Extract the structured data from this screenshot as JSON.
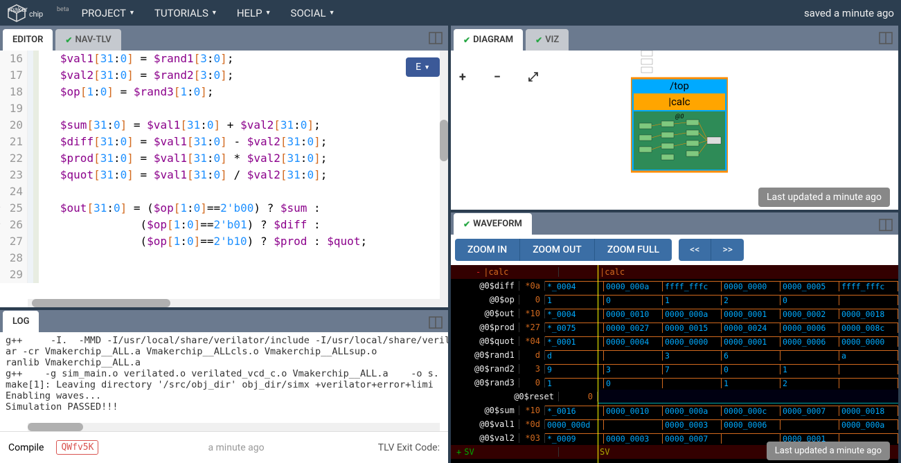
{
  "header": {
    "logo": "makerchip",
    "beta": "beta",
    "menu": [
      "PROJECT",
      "TUTORIALS",
      "HELP",
      "SOCIAL"
    ],
    "saved": "saved a minute ago"
  },
  "editor": {
    "tab_editor": "EDITOR",
    "tab_navtlv": "NAV-TLV",
    "e_btn": "E",
    "lines": [
      {
        "n": "16",
        "code": "   $val1[31:0] = $rand1[3:0];"
      },
      {
        "n": "17",
        "code": "   $val2[31:0] = $rand2[3:0];"
      },
      {
        "n": "18",
        "code": "   $op[1:0] = $rand3[1:0];"
      },
      {
        "n": "19",
        "code": ""
      },
      {
        "n": "20",
        "code": "   $sum[31:0] = $val1[31:0] + $val2[31:0];"
      },
      {
        "n": "21",
        "code": "   $diff[31:0] = $val1[31:0] - $val2[31:0];"
      },
      {
        "n": "22",
        "code": "   $prod[31:0] = $val1[31:0] * $val2[31:0];"
      },
      {
        "n": "23",
        "code": "   $quot[31:0] = $val1[31:0] / $val2[31:0];"
      },
      {
        "n": "24",
        "code": ""
      },
      {
        "n": "25",
        "fold": "▾",
        "code": "   $out[31:0] = ($op[1:0]==2'b00) ? $sum :"
      },
      {
        "n": "26",
        "fold": "▾",
        "code": "               ($op[1:0]==2'b01) ? $diff :"
      },
      {
        "n": "27",
        "code": "               ($op[1:0]==2'b10) ? $prod : $quot;"
      },
      {
        "n": "28",
        "code": ""
      },
      {
        "n": "29",
        "code": ""
      }
    ]
  },
  "log": {
    "tab": "LOG",
    "lines": [
      "g++     -I.  -MMD -I/usr/local/share/verilator/include -I/usr/local/share/verilat",
      "ar -cr Vmakerchip__ALL.a Vmakerchip__ALLcls.o Vmakerchip__ALLsup.o",
      "ranlib Vmakerchip__ALL.a",
      "g++    -g sim_main.o verilated.o verilated_vcd_c.o Vmakerchip__ALL.a    -o s.",
      "make[1]: Leaving directory '/src/obj_dir' obj_dir/simx +verilator+error+limi",
      "Enabling waves...",
      "Simulation PASSED!!!"
    ],
    "compile_label": "Compile",
    "compile_id": "QWfv5K",
    "time": "a minute ago",
    "tlv_exit": "TLV Exit Code:"
  },
  "diagram": {
    "tab_diagram": "DIAGRAM",
    "tab_viz": "VIZ",
    "top_label": "/top",
    "calc_label": "|calc",
    "stage_label": "@0",
    "last_updated": "Last updated a minute ago"
  },
  "waveform": {
    "tab": "WAVEFORM",
    "zoom_in": "ZOOM IN",
    "zoom_out": "ZOOM OUT",
    "zoom_full": "ZOOM FULL",
    "seek_back": "<<",
    "seek_fwd": ">>",
    "header1": "|calc",
    "header2": "|calc",
    "sv": "SV",
    "sv2": "SV",
    "last_updated": "Last updated a minute ago",
    "rows": [
      {
        "label": "@0$diff",
        "cur": "*0a",
        "cells": [
          "*_0004",
          "0000_000a",
          "ffff_fffc",
          "0000_0000",
          "0000_0005",
          "ffff_fffc"
        ]
      },
      {
        "label": "@0$op",
        "cur": "0",
        "cells": [
          "1",
          "0",
          "1",
          "2",
          "0",
          ""
        ]
      },
      {
        "label": "@0$out",
        "cur": "*10",
        "cells": [
          "*_0004",
          "0000_0010",
          "0000_000a",
          "0000_0001",
          "0000_0002",
          "0000_0018"
        ]
      },
      {
        "label": "@0$prod",
        "cur": "*27",
        "cells": [
          "*_0075",
          "0000_0027",
          "0000_0015",
          "0000_0024",
          "0000_0006",
          "0000_008c"
        ]
      },
      {
        "label": "@0$quot",
        "cur": "*04",
        "cells": [
          "*_0001",
          "0000_0004",
          "0000_0000",
          "0000_0001",
          "0000_0006",
          "0000_0000"
        ]
      },
      {
        "label": "@0$rand1",
        "cur": "d",
        "cells": [
          "d",
          "",
          "3",
          "6",
          "",
          "a"
        ]
      },
      {
        "label": "@0$rand2",
        "cur": "3",
        "cells": [
          "9",
          "3",
          "7",
          "0",
          "1",
          ""
        ]
      },
      {
        "label": "@0$rand3",
        "cur": "0",
        "cells": [
          "1",
          "0",
          "",
          "1",
          "2",
          ""
        ]
      },
      {
        "label": "@0$reset",
        "cur": "0",
        "cells": [
          "",
          "",
          "",
          "",
          "",
          ""
        ],
        "reset": true
      },
      {
        "label": "@0$sum",
        "cur": "*10",
        "cells": [
          "*_0016",
          "0000_0010",
          "0000_000a",
          "0000_000c",
          "0000_0007",
          "0000_0018"
        ]
      },
      {
        "label": "@0$val1",
        "cur": "*0d",
        "cells": [
          "0000_000d",
          "",
          "0000_0003",
          "0000_0006",
          "",
          "0000_000a"
        ]
      },
      {
        "label": "@0$val2",
        "cur": "*03",
        "cells": [
          "*_0009",
          "0000_0003",
          "0000_0007",
          "",
          "0000_0001",
          ""
        ]
      }
    ]
  }
}
